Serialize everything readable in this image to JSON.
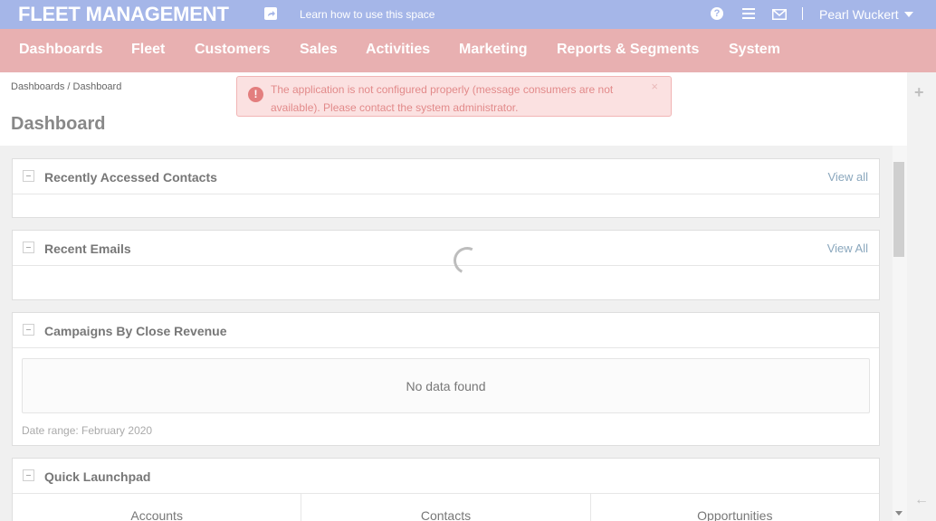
{
  "header": {
    "app_title": "FLEET MANAGEMENT",
    "help_link": "Learn how to use this space",
    "help_icon_text": "?",
    "user_name": "Pearl Wuckert",
    "colors": {
      "header_bg": "#a5b6e8",
      "nav_bg": "#e8b0b1"
    }
  },
  "nav": {
    "items": [
      {
        "label": "Dashboards"
      },
      {
        "label": "Fleet"
      },
      {
        "label": "Customers"
      },
      {
        "label": "Sales"
      },
      {
        "label": "Activities"
      },
      {
        "label": "Marketing"
      },
      {
        "label": "Reports & Segments"
      },
      {
        "label": "System"
      }
    ]
  },
  "breadcrumb": {
    "root": "Dashboards",
    "separator": "/",
    "current": "Dashboard"
  },
  "page_title": "Dashboard",
  "alert": {
    "icon_text": "!",
    "message": "The application is not configured properly (message consumers are not available). Please contact the system administrator.",
    "close": "×"
  },
  "widgets": {
    "recent_contacts": {
      "title": "Recently Accessed Contacts",
      "link": "View all"
    },
    "recent_emails": {
      "title": "Recent Emails",
      "link": "View All"
    },
    "campaigns": {
      "title": "Campaigns By Close Revenue",
      "empty": "No data found",
      "date_range": "Date range: February 2020"
    },
    "launchpad": {
      "title": "Quick Launchpad",
      "columns": [
        "Accounts",
        "Contacts",
        "Opportunities"
      ]
    }
  },
  "icons": {
    "plus": "+",
    "back": "←"
  }
}
